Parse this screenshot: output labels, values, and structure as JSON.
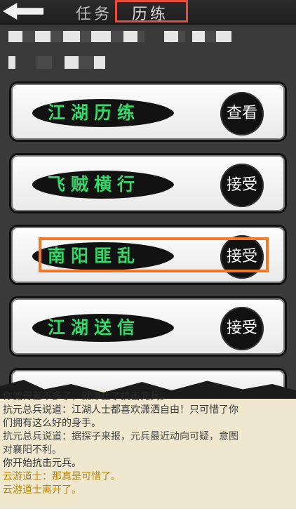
{
  "header": {
    "tabs": [
      {
        "label": "任务"
      },
      {
        "label": "历练"
      }
    ]
  },
  "cards": [
    {
      "title": "江湖历练",
      "action": "查看"
    },
    {
      "title": "飞贼横行",
      "action": "接受"
    },
    {
      "title": "南阳匪乱",
      "action": "接受"
    },
    {
      "title": "江湖送信",
      "action": "接受"
    }
  ],
  "chat": {
    "lines": [
      "你觉得差不多了，就停止了抗击元兵。",
      "抗元总兵说道：江湖人士都喜欢潇洒自由！只可惜了你",
      "们拥有这么好的身手。",
      "抗元总兵说道：据探子来报，元兵最近动向可疑，意图",
      "对襄阳不利。",
      "你开始抗击元兵。",
      "云游道士：那真是可惜了。",
      "云游道士离开了。"
    ]
  },
  "colors": {
    "highlight_tab": "#e84c3d",
    "highlight_card": "#f07a2a",
    "card_title": "#35d66a"
  }
}
